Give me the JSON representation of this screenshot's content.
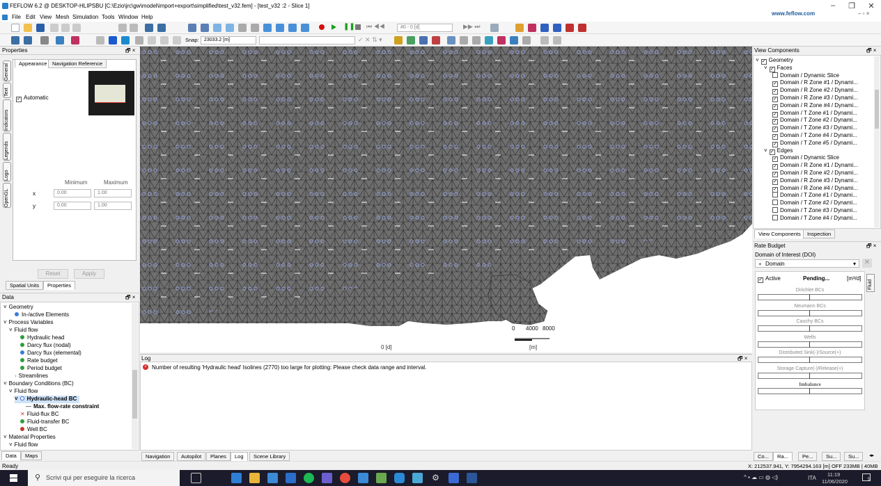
{
  "window": {
    "title": "FEFLOW 6.2 @ DESKTOP-HLIPSBU [C:\\Ezio\\jrc\\gw\\model\\import+export\\simplified\\test_v32.fem] - [test_v32 :2 - Slice 1]",
    "brand": "www.feflow.com"
  },
  "menu": [
    "File",
    "Edit",
    "View",
    "Mesh",
    "Simulation",
    "Tools",
    "Window",
    "Help"
  ],
  "toolbar": {
    "time_value": "#0 - 0 [d]",
    "snap_label": "Snap:",
    "snap_value": "23033.2 [m]"
  },
  "properties": {
    "title": "Properties",
    "tabs": [
      "Appearance",
      "Navigation Reference"
    ],
    "vertical_tabs": [
      "General",
      "Text",
      "Indicators",
      "Legends",
      "Logo",
      "OpenGL"
    ],
    "automatic_label": "Automatic",
    "min_label": "Minimum",
    "max_label": "Maximum",
    "x_label": "x",
    "y_label": "y",
    "x_min": "0.00",
    "x_max": "1.00",
    "y_min": "0.00",
    "y_max": "1.00",
    "reset": "Reset",
    "apply": "Apply",
    "bottom_tabs": [
      "Spatial Units",
      "Properties"
    ]
  },
  "data_panel": {
    "title": "Data",
    "items": [
      {
        "label": "Geometry",
        "indent": 0,
        "kind": "caret"
      },
      {
        "label": "In-/active Elements",
        "indent": 2,
        "kind": "dot",
        "color": "#3b7dd8"
      },
      {
        "label": "Process Variables",
        "indent": 0,
        "kind": "caret"
      },
      {
        "label": "Fluid flow",
        "indent": 1,
        "kind": "caret"
      },
      {
        "label": "Hydraulic head",
        "indent": 3,
        "kind": "dot",
        "color": "#2e9e3a"
      },
      {
        "label": "Darcy flux (nodal)",
        "indent": 3,
        "kind": "dot",
        "color": "#2e9e3a"
      },
      {
        "label": "Darcy flux (elemental)",
        "indent": 3,
        "kind": "dot",
        "color": "#3b7dd8"
      },
      {
        "label": "Rate budget",
        "indent": 3,
        "kind": "dot",
        "color": "#2e9e3a"
      },
      {
        "label": "Period budget",
        "indent": 3,
        "kind": "dot",
        "color": "#2e9e3a"
      },
      {
        "label": "Streamlines",
        "indent": 2,
        "kind": "arrow"
      },
      {
        "label": "Boundary Conditions (BC)",
        "indent": 0,
        "kind": "caret"
      },
      {
        "label": "Fluid flow",
        "indent": 1,
        "kind": "caret"
      },
      {
        "label": "Hydraulic-head BC",
        "indent": 2,
        "kind": "selected"
      },
      {
        "label": "Max. flow-rate constraint",
        "indent": 4,
        "kind": "dash"
      },
      {
        "label": "Fluid-flux BC",
        "indent": 3,
        "kind": "x"
      },
      {
        "label": "Fluid-transfer BC",
        "indent": 3,
        "kind": "dot",
        "color": "#2e9e3a"
      },
      {
        "label": "Well BC",
        "indent": 3,
        "kind": "dot",
        "color": "#c0392b"
      },
      {
        "label": "Material Properties",
        "indent": 0,
        "kind": "caret"
      },
      {
        "label": "Fluid flow",
        "indent": 1,
        "kind": "caret"
      }
    ],
    "bottom_tabs": [
      "Data",
      "Maps"
    ]
  },
  "viewport": {
    "time_label": "0 [d]",
    "unit_label": "[m]",
    "scale_left": "0",
    "scale_mid": "4000",
    "scale_right": "8000"
  },
  "log": {
    "title": "Log",
    "message": "Number of resulting 'Hydraulic head' Isolines (2770) too large for plotting: Please check data range and interval."
  },
  "bottom_tabs": [
    "Navigation",
    "Autopilot",
    "Planes",
    "Log",
    "Scene Library"
  ],
  "view_components": {
    "title": "View Components",
    "items": [
      {
        "label": "Geometry",
        "indent": 0,
        "checked": true,
        "group": true
      },
      {
        "label": "Faces",
        "indent": 1,
        "checked": true,
        "group": true
      },
      {
        "label": "Domain / Dynamic Slice",
        "indent": 2,
        "checked": false
      },
      {
        "label": "Domain / R Zone #1 / Dynami...",
        "indent": 2,
        "checked": true
      },
      {
        "label": "Domain / R Zone #2 / Dynami...",
        "indent": 2,
        "checked": true
      },
      {
        "label": "Domain / R Zone #3 / Dynami...",
        "indent": 2,
        "checked": true
      },
      {
        "label": "Domain / R Zone #4 / Dynami...",
        "indent": 2,
        "checked": true
      },
      {
        "label": "Domain / T Zone #1 / Dynami...",
        "indent": 2,
        "checked": true
      },
      {
        "label": "Domain / T Zone #2 / Dynami...",
        "indent": 2,
        "checked": true
      },
      {
        "label": "Domain / T Zone #3 / Dynami...",
        "indent": 2,
        "checked": true
      },
      {
        "label": "Domain / T Zone #4 / Dynami...",
        "indent": 2,
        "checked": true
      },
      {
        "label": "Domain / T Zone #5 / Dynami...",
        "indent": 2,
        "checked": true
      },
      {
        "label": "Edges",
        "indent": 1,
        "checked": true,
        "group": true
      },
      {
        "label": "Domain / Dynamic Slice",
        "indent": 2,
        "checked": true
      },
      {
        "label": "Domain / R Zone #1 / Dynami...",
        "indent": 2,
        "checked": true
      },
      {
        "label": "Domain / R Zone #2 / Dynami...",
        "indent": 2,
        "checked": true
      },
      {
        "label": "Domain / R Zone #3 / Dynami...",
        "indent": 2,
        "checked": true
      },
      {
        "label": "Domain / R Zone #4 / Dynami...",
        "indent": 2,
        "checked": true
      },
      {
        "label": "Domain / T Zone #1 / Dynami...",
        "indent": 2,
        "checked": false
      },
      {
        "label": "Domain / T Zone #2 / Dynami...",
        "indent": 2,
        "checked": false
      },
      {
        "label": "Domain / T Zone #3 / Dynami...",
        "indent": 2,
        "checked": false
      },
      {
        "label": "Domain / T Zone #4 / Dynami...",
        "indent": 2,
        "checked": false
      }
    ],
    "tabs": [
      "View Components",
      "Inspection"
    ]
  },
  "rate_budget": {
    "title": "Rate Budget",
    "doi_label": "Domain of Interest (DOI)",
    "doi_value": "Domain",
    "active_label": "Active",
    "status": "Pending...",
    "unit": "[m³/d]",
    "side_tab": "Fluid",
    "bars": [
      "Dirichlet BCs",
      "Neumann BCs",
      "Cauchy BCs",
      "Wells",
      "Distributed Sink(-)/Source(+)",
      "Storage Capture(-)/Release(+)"
    ],
    "imbalance": "Imbalance"
  },
  "right_bottom_tabs": [
    "Co...",
    "Ra...",
    "Pe...",
    "Su...",
    "Su..."
  ],
  "status": {
    "left": "Ready",
    "right": "X: 212537.941, Y: 7954294.163 [m]  OFF  233MB | 40MB"
  },
  "taskbar": {
    "search_placeholder": "Scrivi qui per eseguire la ricerca",
    "time": "11:19",
    "date": "11/06/2020",
    "lang": "ITA",
    "badge": "5"
  }
}
